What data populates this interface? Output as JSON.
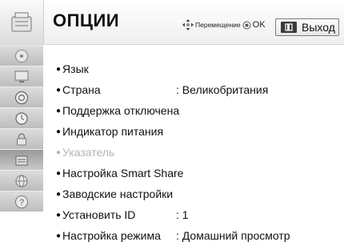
{
  "header": {
    "title": "ОПЦИИ",
    "nav_hint": "Перемещение",
    "ok_label": "OK",
    "exit_label": "Выход"
  },
  "sidebar": {
    "icons": [
      "disc-icon",
      "monitor-icon",
      "speaker-icon",
      "clock-icon",
      "lock-icon",
      "options-icon",
      "network-icon",
      "help-icon"
    ],
    "active_index": 5
  },
  "menu": {
    "items": [
      {
        "label": "Язык",
        "value": "",
        "disabled": false
      },
      {
        "label": "Страна",
        "value": ": Великобритания",
        "disabled": false
      },
      {
        "label": "Поддержка отключена",
        "value": "",
        "disabled": false
      },
      {
        "label": "Индикатор питания",
        "value": "",
        "disabled": false
      },
      {
        "label": "Указатель",
        "value": "",
        "disabled": true
      },
      {
        "label": "Настройка Smart Share",
        "value": "",
        "disabled": false
      },
      {
        "label": "Заводские настройки",
        "value": "",
        "disabled": false
      },
      {
        "label": "Установить ID",
        "value": ": 1",
        "disabled": false
      },
      {
        "label": "Настройка режима",
        "value": ": Домашний просмотр",
        "disabled": false
      }
    ]
  },
  "colors": {
    "disabled_text": "#b4b4b4",
    "sidebar_bg": "#c8c8c8"
  }
}
